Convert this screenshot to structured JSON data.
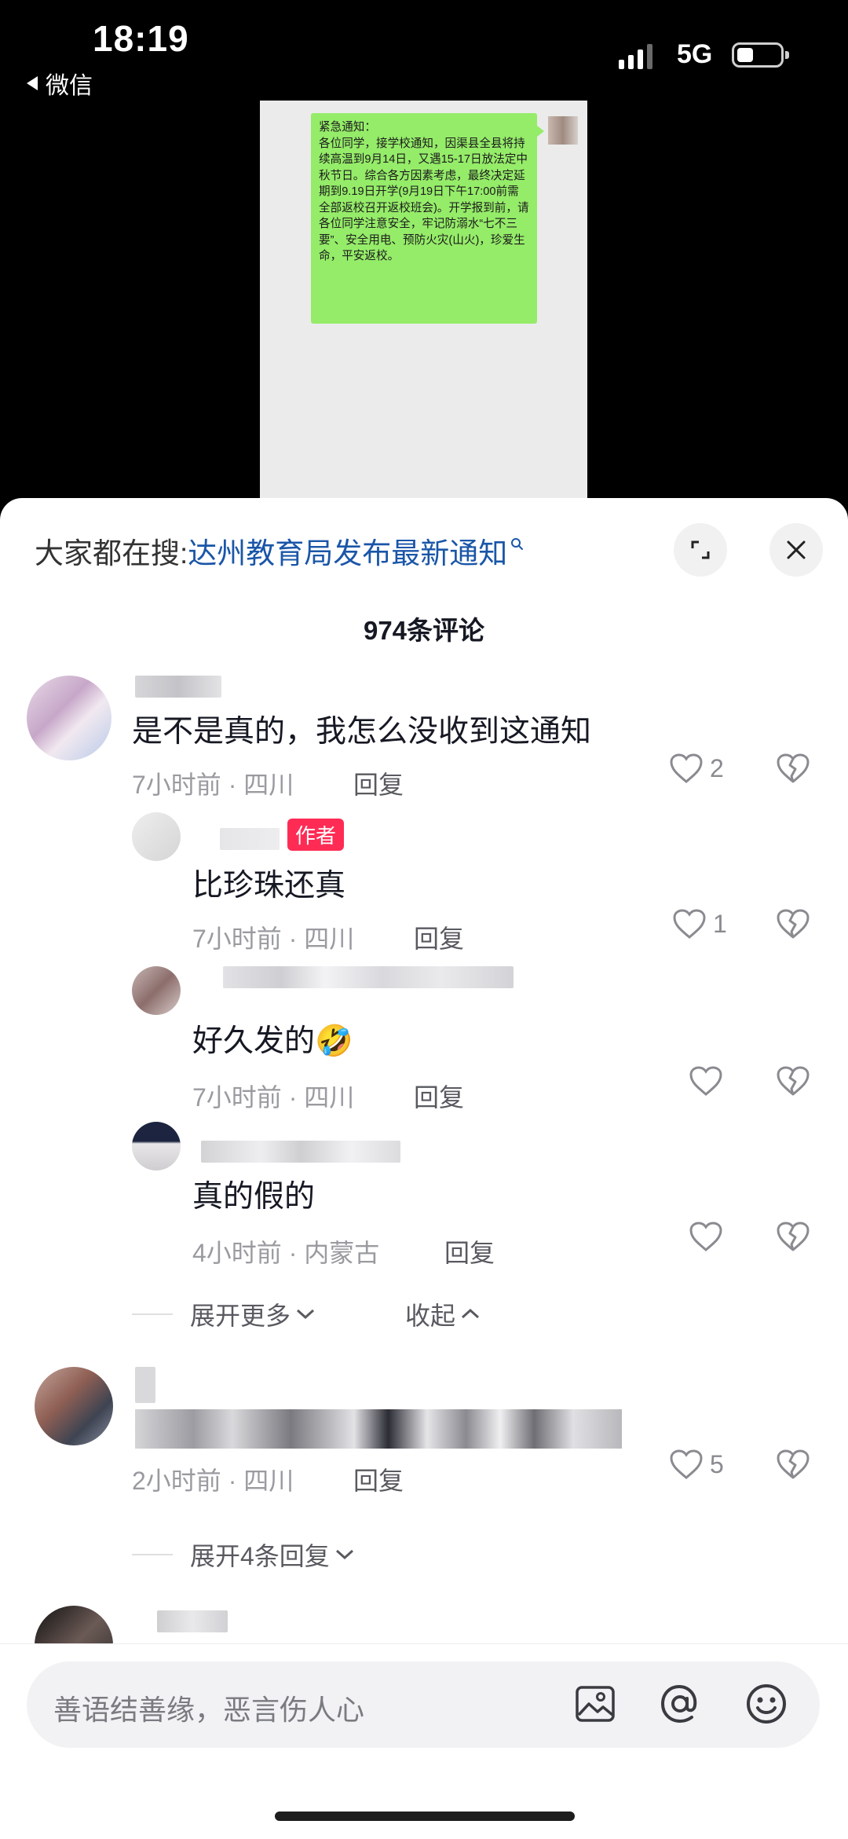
{
  "status_bar": {
    "time": "18:19",
    "back_app": "微信",
    "network": "5G"
  },
  "video": {
    "notice_text": "紧急通知：\n各位同学，接学校通知，因渠县全县将持续高温到9月14日，又遇15-17日放法定中秋节日。综合各方因素考虑，最终决定延期到9.19日开学(9月19日下午17:00前需全部返校召开返校班会)。开学报到前，请各位同学注意安全，牢记防溺水“七不三要”、安全用电、预防火灾(山火)，珍爱生命，平安返校。"
  },
  "search": {
    "prefix": "大家都在搜:",
    "term": "达州教育局发布最新通知"
  },
  "comments_count": "974条评论",
  "comments": [
    {
      "text": "是不是真的，我怎么没收到这通知",
      "meta": "7小时前 · 四川",
      "reply": "回复",
      "likes": "2"
    },
    {
      "text": "比珍珠还真",
      "badge": "作者",
      "meta": "7小时前 · 四川",
      "reply": "回复",
      "likes": "1"
    },
    {
      "text": "好久发的🤣",
      "meta": "7小时前 · 四川",
      "reply": "回复",
      "likes": ""
    },
    {
      "text": "真的假的",
      "meta": "4小时前 · 内蒙古",
      "reply": "回复",
      "likes": ""
    },
    {
      "meta": "2小时前 · 四川",
      "reply": "回复",
      "likes": "5"
    }
  ],
  "fold": {
    "expand_more": "展开更多",
    "collapse": "收起",
    "expand_replies": "展开4条回复"
  },
  "input": {
    "placeholder": "善语结善缘，恶言伤人心"
  },
  "icons": [
    "chevron-left-icon",
    "signal-icon",
    "battery-icon",
    "search-icon",
    "expand-icon",
    "close-icon",
    "heart-icon",
    "broken-heart-icon",
    "chevron-down-icon",
    "chevron-up-icon",
    "image-icon",
    "at-icon",
    "emoji-icon"
  ],
  "colors": {
    "accent": "#fe2c55",
    "search_link": "#1a56a8",
    "bubble_green": "#95ec69"
  }
}
